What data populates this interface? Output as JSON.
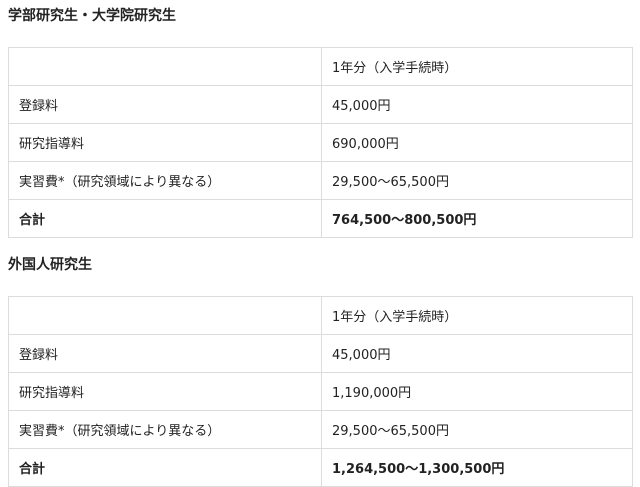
{
  "sections": [
    {
      "heading": "学部研究生・大学院研究生",
      "table": {
        "header": [
          "",
          "1年分（入学手続時）"
        ],
        "rows": [
          [
            "登録料",
            "45,000円"
          ],
          [
            "研究指導料",
            "690,000円"
          ],
          [
            "実習費*（研究領域により異なる）",
            "29,500～65,500円"
          ],
          [
            "合計",
            "764,500～800,500円"
          ]
        ]
      }
    },
    {
      "heading": "外国人研究生",
      "table": {
        "header": [
          "",
          "1年分（入学手続時）"
        ],
        "rows": [
          [
            "登録料",
            "45,000円"
          ],
          [
            "研究指導料",
            "1,190,000円"
          ],
          [
            "実習費*（研究領域により異なる）",
            "29,500～65,500円"
          ],
          [
            "合計",
            "1,264,500～1,300,500円"
          ]
        ]
      }
    }
  ]
}
